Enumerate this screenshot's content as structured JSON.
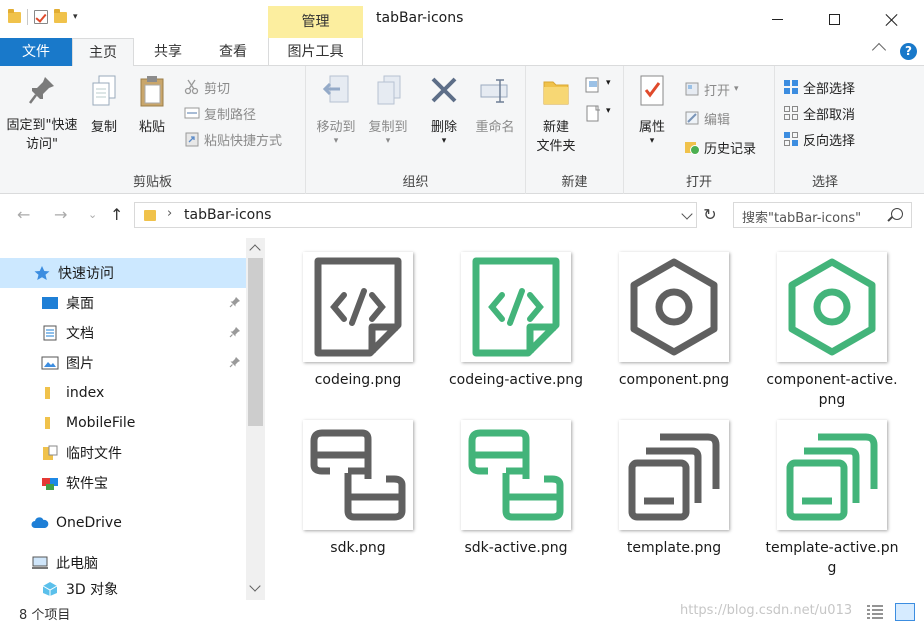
{
  "window": {
    "title": "tabBar-icons",
    "context_tab": "管理"
  },
  "ribbon_tabs": {
    "file": "文件",
    "home": "主页",
    "share": "共享",
    "view": "查看",
    "picture_tools": "图片工具"
  },
  "ribbon": {
    "clipboard": {
      "label": "剪贴板",
      "pin": "固定到\"快速访问\"",
      "copy": "复制",
      "paste": "粘贴",
      "cut": "剪切",
      "copy_path": "复制路径",
      "paste_shortcut": "粘贴快捷方式"
    },
    "organize": {
      "label": "组织",
      "move_to": "移动到",
      "copy_to": "复制到",
      "delete": "删除",
      "rename": "重命名"
    },
    "new": {
      "label": "新建",
      "new_folder": "新建\n文件夹"
    },
    "open": {
      "label": "打开",
      "properties": "属性",
      "open": "打开",
      "edit": "编辑",
      "history": "历史记录"
    },
    "select": {
      "label": "选择",
      "select_all": "全部选择",
      "select_none": "全部取消",
      "invert": "反向选择"
    }
  },
  "address": {
    "crumb": "tabBar-icons",
    "search_placeholder": "搜索\"tabBar-icons\""
  },
  "nav_pane": {
    "quick_access": "快速访问",
    "items": [
      {
        "label": "桌面",
        "pinned": true
      },
      {
        "label": "文档",
        "pinned": true
      },
      {
        "label": "图片",
        "pinned": true
      },
      {
        "label": "index",
        "pinned": false
      },
      {
        "label": "MobileFile",
        "pinned": false
      },
      {
        "label": "临时文件",
        "pinned": false
      },
      {
        "label": "软件宝",
        "pinned": false
      }
    ],
    "onedrive": "OneDrive",
    "this_pc": "此电脑",
    "objects_3d": "3D 对象"
  },
  "files": [
    {
      "name": "codeing.png",
      "icon": "code-file-icon",
      "color": "#606060"
    },
    {
      "name": "codeing-active.png",
      "icon": "code-file-icon",
      "color": "#43b47a"
    },
    {
      "name": "component.png",
      "icon": "hexagon-icon",
      "color": "#606060"
    },
    {
      "name": "component-active.png",
      "icon": "hexagon-icon",
      "color": "#43b47a"
    },
    {
      "name": "sdk.png",
      "icon": "sdk-icon",
      "color": "#606060"
    },
    {
      "name": "sdk-active.png",
      "icon": "sdk-icon",
      "color": "#43b47a"
    },
    {
      "name": "template.png",
      "icon": "template-icon",
      "color": "#606060"
    },
    {
      "name": "template-active.png",
      "icon": "template-icon",
      "color": "#43b47a"
    }
  ],
  "status": {
    "count": "8 个项目",
    "watermark": "https://blog.csdn.net/u013"
  },
  "colors": {
    "accent": "#1979ca",
    "selected": "#cce8ff",
    "icon_gray": "#606060",
    "icon_green": "#43b47a",
    "manage_tab": "#fcee9f"
  }
}
